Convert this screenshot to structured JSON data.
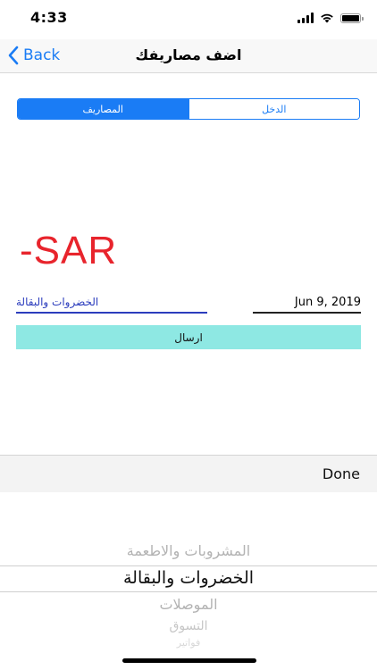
{
  "status_bar": {
    "time": "4:33",
    "icons": [
      "signal-icon",
      "wifi-icon",
      "battery-icon"
    ]
  },
  "nav": {
    "back_label": "Back",
    "title": "اضف مصاريفك"
  },
  "segments": {
    "expenses": "المصاريف",
    "income": "الدخل"
  },
  "amount": "-SAR",
  "form": {
    "category": "الخضروات والبقالة",
    "date": "Jun 9, 2019",
    "send_label": "ارسال"
  },
  "picker": {
    "done_label": "Done",
    "rows": [
      "المشروبات والاطعمة",
      "الخضروات والبقالة",
      "الموصلات",
      "التسوق",
      "فواتير"
    ]
  },
  "colors": {
    "accent": "#1a7cf5",
    "amount": "#e8242c",
    "send_button": "#8ee8e3",
    "field_underline": "#2c3dbd"
  }
}
